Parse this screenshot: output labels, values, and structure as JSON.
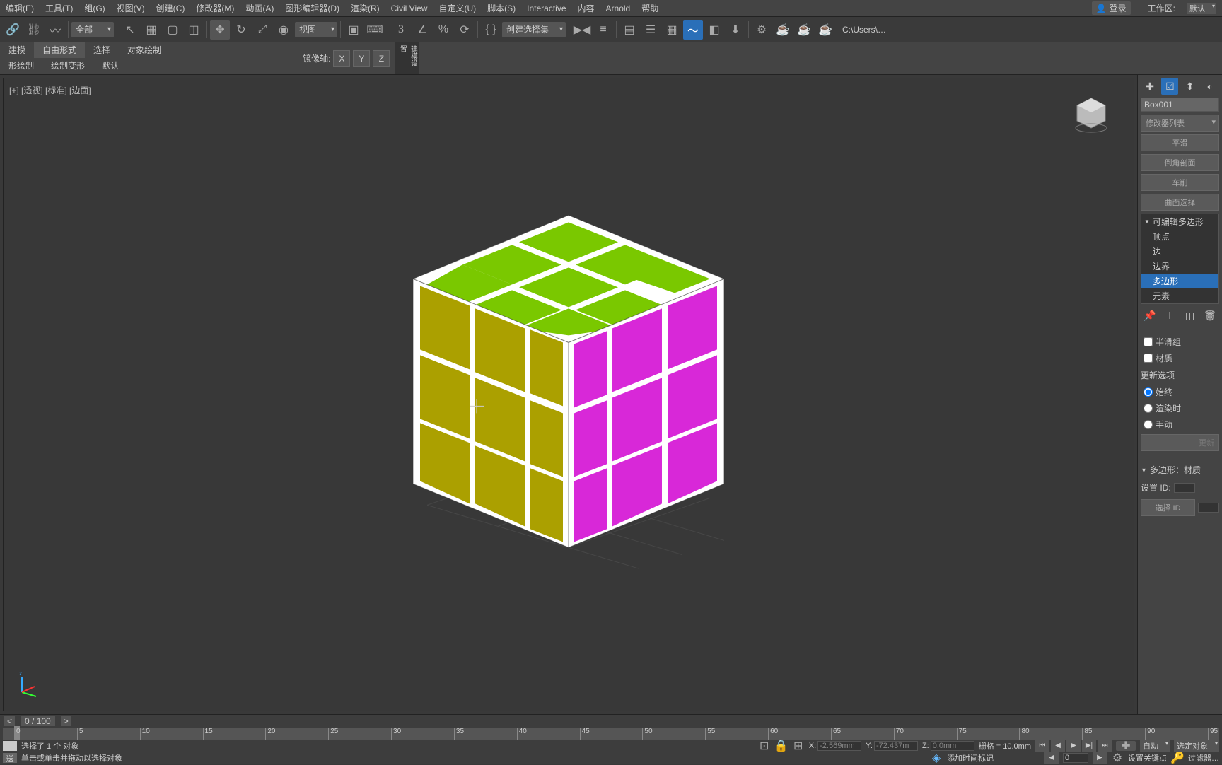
{
  "menu": {
    "items": [
      "编辑(E)",
      "工具(T)",
      "组(G)",
      "视图(V)",
      "创建(C)",
      "修改器(M)",
      "动画(A)",
      "图形编辑器(D)",
      "渲染(R)",
      "Civil View",
      "自定义(U)",
      "脚本(S)",
      "Interactive",
      "内容",
      "Arnold",
      "帮助"
    ],
    "login": "登录",
    "workspace_label": "工作区:",
    "workspace_value": "默认"
  },
  "toolbar": {
    "all": "全部",
    "view": "视图",
    "create_set": "创建选择集",
    "path": "C:\\Users\\…"
  },
  "ribbon": {
    "tabs": [
      "建模",
      "自由形式",
      "选择",
      "对象绘制"
    ],
    "subs": [
      "形绘制",
      "绘制变形",
      "默认"
    ],
    "mirror_label": "镜像轴:",
    "axes": [
      "X",
      "Y",
      "Z"
    ],
    "vert_label": "建模设置"
  },
  "viewport": {
    "label": "[+] [透视] [标准] [边面]"
  },
  "right_panel": {
    "object_name": "Box001",
    "mod_list_label": "修改器列表",
    "btns": [
      "平滑",
      "倒角剖面",
      "车削",
      "曲面选择"
    ],
    "modifier_parent": "可编辑多边形",
    "sub_items": [
      "顶点",
      "边",
      "边界",
      "多边形",
      "元素"
    ],
    "smooth_group": "半滑组",
    "material": "材质",
    "update_options": "更新选项",
    "radios": [
      "始终",
      "渲染时",
      "手动"
    ],
    "update_btn": "更新",
    "poly_material": "多边形：材质",
    "set_id": "设置 ID:",
    "select_id": "选择 ID"
  },
  "bottom": {
    "frame_display": "0 / 100",
    "nav_arrows": [
      "<",
      ">"
    ],
    "ticks": [
      0,
      5,
      10,
      15,
      20,
      25,
      30,
      35,
      40,
      45,
      50,
      55,
      60,
      65,
      70,
      75,
      80,
      85,
      90,
      95
    ],
    "selected_msg": "选择了 1 个 对象",
    "hint_msg": "单击或单击并拖动以选择对象",
    "x_val": "-2.569mm",
    "y_val": "-72.437m",
    "z_val": "0.0mm",
    "grid": "栅格 = 10.0mm",
    "add_time_tag": "添加时间标记",
    "auto": "自动",
    "selected_obj": "选定对象",
    "set_keys": "设置关键点",
    "filter": "过滤器…",
    "frame_num": "0",
    "send_btn": "送"
  }
}
